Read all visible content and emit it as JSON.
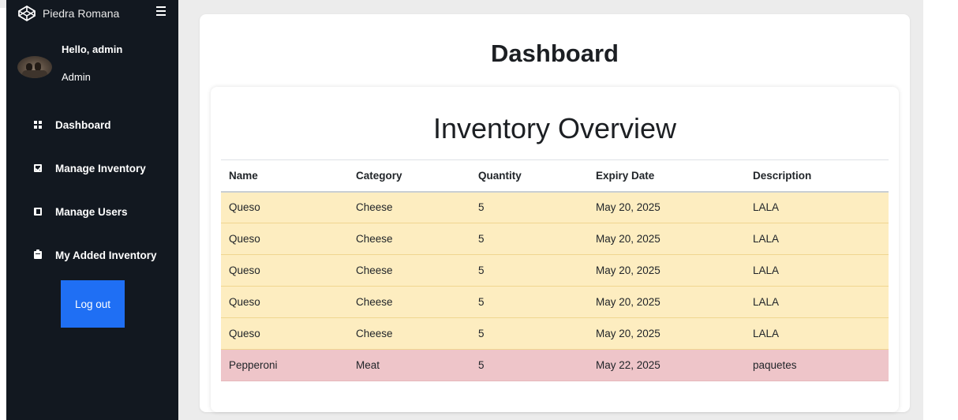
{
  "sidebar": {
    "brand": "Piedra Romana",
    "greeting": "Hello, admin",
    "role": "Admin",
    "items": [
      {
        "label": "Dashboard",
        "icon": "grid-icon"
      },
      {
        "label": "Manage Inventory",
        "icon": "clipboard-check-icon"
      },
      {
        "label": "Manage Users",
        "icon": "users-icon"
      },
      {
        "label": "My Added Inventory",
        "icon": "clipboard-icon"
      }
    ],
    "logout_label": "Log out"
  },
  "main": {
    "page_title": "Dashboard",
    "section_title": "Inventory Overview",
    "table": {
      "headers": [
        "Name",
        "Category",
        "Quantity",
        "Expiry Date",
        "Description"
      ],
      "rows": [
        {
          "status": "warning",
          "cells": [
            "Queso",
            "Cheese",
            "5",
            "May 20, 2025",
            "LALA"
          ]
        },
        {
          "status": "warning",
          "cells": [
            "Queso",
            "Cheese",
            "5",
            "May 20, 2025",
            "LALA"
          ]
        },
        {
          "status": "warning",
          "cells": [
            "Queso",
            "Cheese",
            "5",
            "May 20, 2025",
            "LALA"
          ]
        },
        {
          "status": "warning",
          "cells": [
            "Queso",
            "Cheese",
            "5",
            "May 20, 2025",
            "LALA"
          ]
        },
        {
          "status": "warning",
          "cells": [
            "Queso",
            "Cheese",
            "5",
            "May 20, 2025",
            "LALA"
          ]
        },
        {
          "status": "danger",
          "cells": [
            "Pepperoni",
            "Meat",
            "5",
            "May 22, 2025",
            "paquetes"
          ]
        }
      ]
    }
  },
  "colors": {
    "sidebar_bg": "#121820",
    "accent": "#1f6ff4",
    "warning_row": "#fdedc0",
    "danger_row": "#eec5c9"
  }
}
